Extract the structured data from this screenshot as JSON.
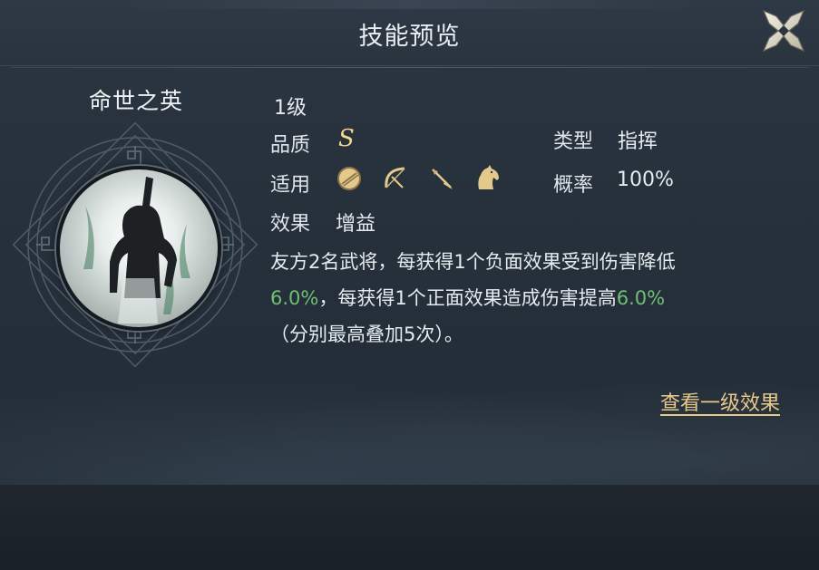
{
  "header": {
    "title": "技能预览"
  },
  "skill": {
    "name": "命世之英",
    "level": "1级",
    "quality_label": "品质",
    "quality_value": "S",
    "type_label": "类型",
    "type_value": "指挥",
    "apply_label": "适用",
    "apply_icons": [
      "shield-icon",
      "bow-icon",
      "spear-icon",
      "horse-icon"
    ],
    "rate_label": "概率",
    "rate_value": "100%",
    "effect_label": "效果",
    "effect_value": "增益",
    "description": {
      "line1": "友方2名武将，每获得1个负面效果受到伤害降低",
      "value1": "6.0%",
      "line2_mid": "，每获得1个正面效果造成伤害提高",
      "value2": "6.0%",
      "line3": "（分别最高叠加5次）。"
    }
  },
  "links": {
    "view_level1": "查看一级效果"
  },
  "colors": {
    "highlight": "#6fbf73",
    "gold": "#e8c98a",
    "panel": "#26313c"
  }
}
